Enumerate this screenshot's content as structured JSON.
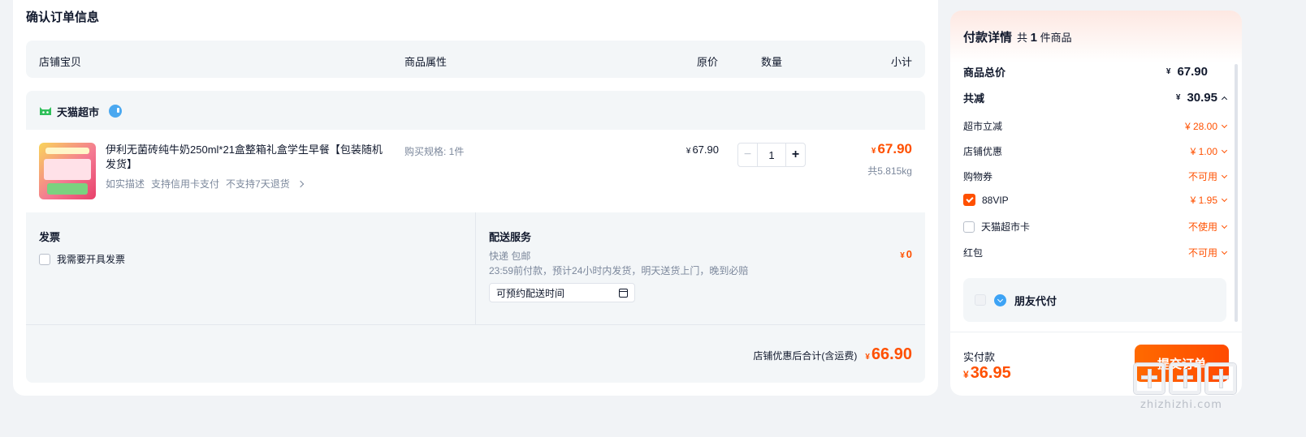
{
  "page": {
    "title": "确认订单信息"
  },
  "table_head": {
    "shop": "店铺宝贝",
    "attr": "商品属性",
    "price": "原价",
    "qty": "数量",
    "subtotal": "小计"
  },
  "store": {
    "name": "天猫超市",
    "item": {
      "title": "伊利无菌砖纯牛奶250ml*21盒整箱礼盒学生早餐【包装随机发货】",
      "tags": [
        "如实描述",
        "支持信用卡支付",
        "不支持7天退货"
      ],
      "spec": "购买规格: 1件",
      "unit_price": "67.90",
      "quantity": "1",
      "subtotal": "67.90",
      "weight": "共5.815kg"
    },
    "invoice": {
      "title": "发票",
      "checkbox_label": "我需要开具发票"
    },
    "delivery": {
      "title": "配送服务",
      "method": "快递 包邮",
      "note": "23:59前付款，预计24小时内发货，明天送货上门，晚到必赔",
      "schedule_placeholder": "可预约配送时间",
      "fee": "0"
    },
    "total_label": "店铺优惠后合计(含运费)",
    "total_value": "66.90"
  },
  "currency": "¥",
  "payment": {
    "title": "付款详情",
    "count_prefix": "共",
    "count": "1",
    "count_suffix": "件商品",
    "goods_total_label": "商品总价",
    "goods_total": "67.90",
    "discount_label": "共减",
    "discount_total": "30.95",
    "lines": [
      {
        "label": "超市立减",
        "value": "¥ 28.00"
      },
      {
        "label": "店铺优惠",
        "value": "¥ 1.00"
      },
      {
        "label": "购物券",
        "value": "不可用"
      },
      {
        "label": "88VIP",
        "value": "¥ 1.95"
      },
      {
        "label": "天猫超市卡",
        "value": "不使用"
      },
      {
        "label": "红包",
        "value": "不可用"
      }
    ],
    "friend_pay": "朋友代付",
    "paid_label": "实付款",
    "paid_value": "36.95",
    "submit": "提交订单"
  },
  "watermark": {
    "text": "zhizhizhi.com"
  },
  "colors": {
    "accent": "#ff5000",
    "text": "#11192d",
    "muted": "#7c889c",
    "panel_bg": "#f3f6f8"
  }
}
